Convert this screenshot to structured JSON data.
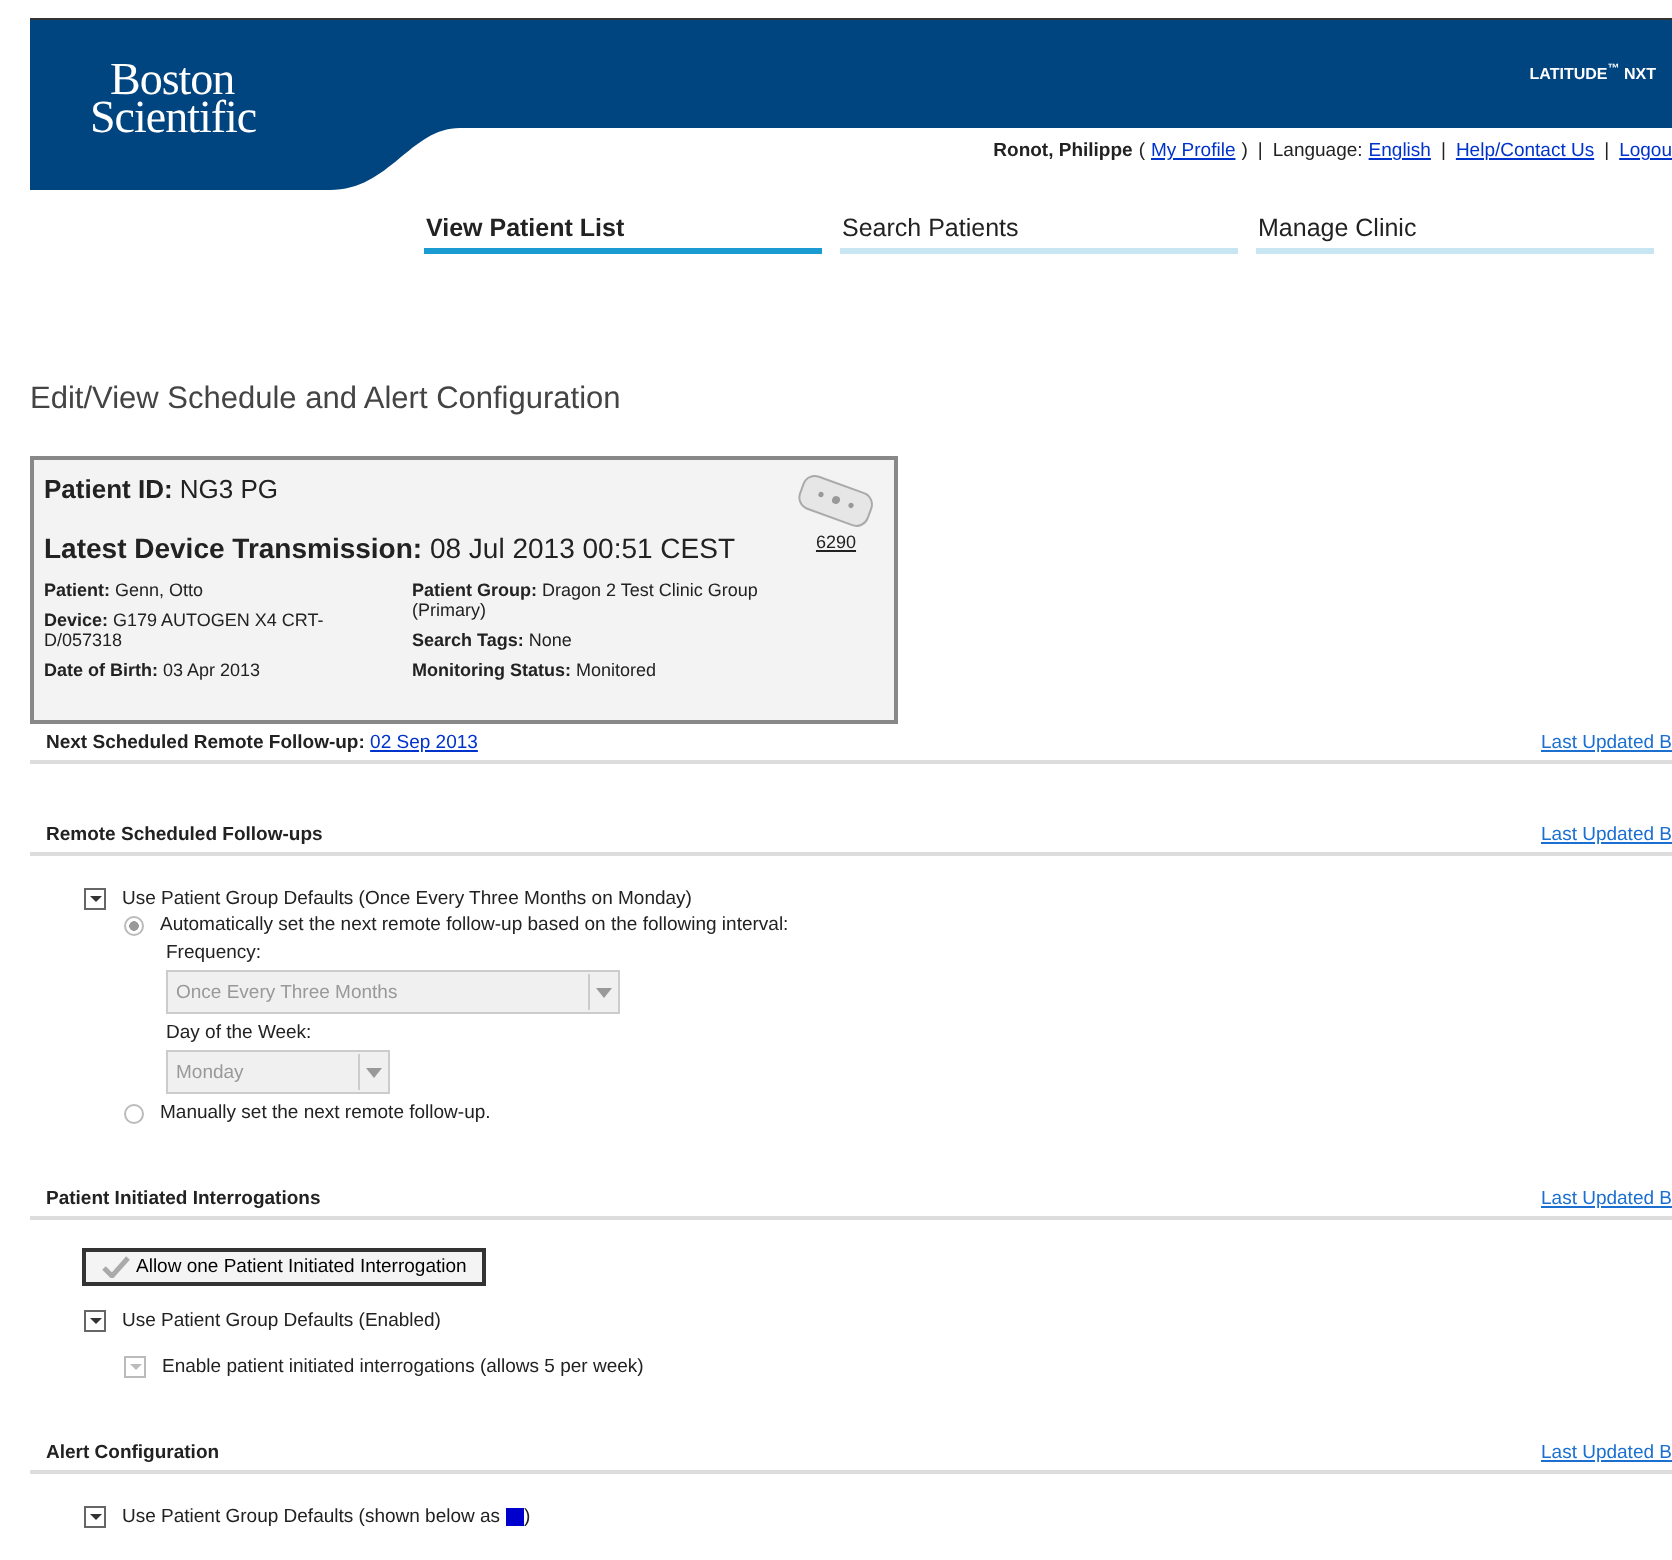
{
  "header": {
    "logo_lines": [
      "Boston",
      "Scientific"
    ],
    "product": "LATITUDE",
    "product_mark": "™",
    "product_suffix": "NXT"
  },
  "user_bar": [
    {
      "kind": "name",
      "text": "Ronot, Philippe"
    },
    {
      "kind": "punct",
      "text": "("
    },
    {
      "kind": "link",
      "text": "My Profile"
    },
    {
      "kind": "punct",
      "text": ")"
    },
    {
      "kind": "sep",
      "text": "|"
    },
    {
      "kind": "label",
      "text": "Language:"
    },
    {
      "kind": "link",
      "text": "English"
    },
    {
      "kind": "sep",
      "text": "|"
    },
    {
      "kind": "link",
      "text": "Help/Contact Us"
    },
    {
      "kind": "sep",
      "text": "|"
    },
    {
      "kind": "link",
      "text": "Logou"
    }
  ],
  "tabs": [
    {
      "label": "View Patient List",
      "selected": true
    },
    {
      "label": "Search Patients",
      "selected": false
    },
    {
      "label": "Manage Clinic",
      "selected": false
    }
  ],
  "page_title": "Edit/View Schedule and Alert Configuration",
  "patient_card": {
    "id_label": "Patient ID:",
    "id_value": "NG3 PG",
    "transmission_label": "Latest Device Transmission:",
    "transmission_value": "08 Jul 2013 00:51 CEST",
    "device_code": "6290",
    "left_fields": [
      {
        "label": "Patient:",
        "value": "Genn, Otto"
      },
      {
        "label": "Device:",
        "value": "G179 AUTOGEN X4 CRT-D/057318"
      },
      {
        "label": "Date of Birth:",
        "value": "03 Apr 2013"
      }
    ],
    "right_fields": [
      {
        "label": "Patient Group:",
        "value": "Dragon 2 Test Clinic Group (Primary)"
      },
      {
        "label": "Search Tags:",
        "value": "None"
      },
      {
        "label": "Monitoring Status:",
        "value": "Monitored"
      }
    ]
  },
  "next_follow_up": {
    "label": "Next Scheduled Remote Follow-up:",
    "link": "02 Sep 2013",
    "last_updated": "Last Updated B"
  },
  "remote_follow_ups": {
    "title": "Remote Scheduled Follow-ups",
    "last_updated": "Last Updated B",
    "use_defaults": {
      "label": "Use Patient Group Defaults (Once Every Three Months on Monday)",
      "checked": true
    },
    "auto": {
      "label": "Automatically set the next remote follow-up based on the following interval:",
      "selected": true
    },
    "frequency_label": "Frequency:",
    "frequency_value": "Once Every Three Months",
    "day_label": "Day of the Week:",
    "day_value": "Monday",
    "manual": {
      "label": "Manually set the next remote follow-up.",
      "selected": false
    }
  },
  "interrogations": {
    "title": "Patient Initiated Interrogations",
    "last_updated": "Last Updated B",
    "button": "Allow one Patient Initiated Interrogation",
    "use_defaults": {
      "label": "Use Patient Group Defaults (Enabled)",
      "checked": true,
      "disabled": false
    },
    "enable": {
      "label": "Enable patient initiated interrogations (allows 5 per week)",
      "checked": true,
      "disabled": true
    }
  },
  "alerts": {
    "title": "Alert Configuration",
    "last_updated": "Last Updated B",
    "use_defaults": {
      "label": "Use Patient Group Defaults (shown below as",
      "checked": true
    },
    "swatch": {
      "color": "#0000cc"
    },
    "suffix": ")"
  }
}
